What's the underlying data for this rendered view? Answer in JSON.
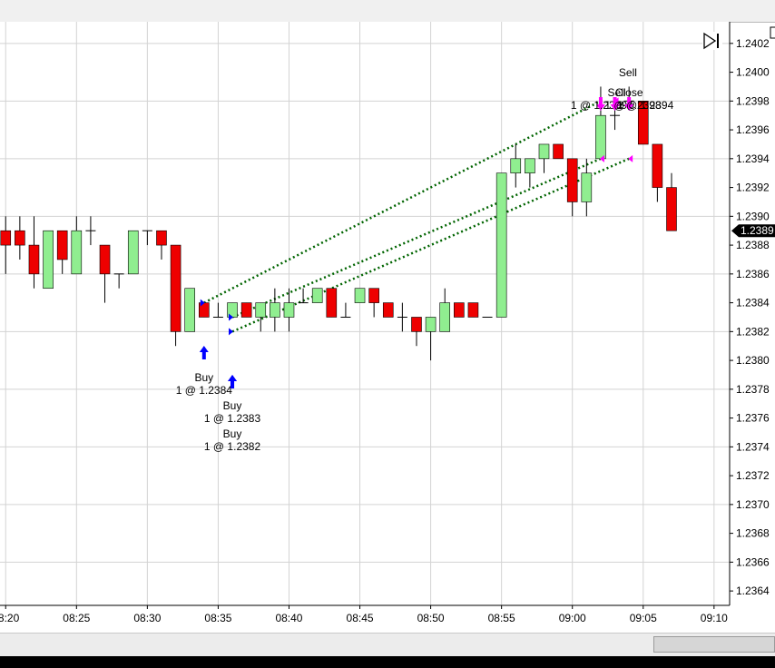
{
  "chart_data": {
    "type": "candlestick",
    "ylim": [
      1.2363,
      1.24035
    ],
    "y_ticks": [
      "1.2364",
      "1.2366",
      "1.2368",
      "1.2370",
      "1.2372",
      "1.2374",
      "1.2376",
      "1.2378",
      "1.2380",
      "1.2382",
      "1.2384",
      "1.2386",
      "1.2388",
      "1.2390",
      "1.2392",
      "1.2394",
      "1.2396",
      "1.2398",
      "1.2400",
      "1.2402"
    ],
    "x_ticks": [
      "08:20",
      "08:25",
      "08:30",
      "08:35",
      "08:40",
      "08:45",
      "08:50",
      "08:55",
      "09:00",
      "09:05",
      "09:10"
    ],
    "x_tick_minutes": [
      500,
      505,
      510,
      515,
      520,
      525,
      530,
      535,
      540,
      545,
      550
    ],
    "xlim_minutes": [
      499.6,
      551.1
    ],
    "last_price": "1.2389",
    "candles": [
      {
        "t": 499,
        "o": 1.239,
        "h": 1.239,
        "l": 1.2389,
        "c": 1.2389
      },
      {
        "t": 500,
        "o": 1.2389,
        "h": 1.239,
        "l": 1.2386,
        "c": 1.2388
      },
      {
        "t": 501,
        "o": 1.2389,
        "h": 1.239,
        "l": 1.2387,
        "c": 1.2388
      },
      {
        "t": 502,
        "o": 1.2388,
        "h": 1.239,
        "l": 1.2385,
        "c": 1.2386
      },
      {
        "t": 503,
        "o": 1.2385,
        "h": 1.2389,
        "l": 1.2385,
        "c": 1.2389
      },
      {
        "t": 504,
        "o": 1.2389,
        "h": 1.2389,
        "l": 1.2386,
        "c": 1.2387
      },
      {
        "t": 505,
        "o": 1.2386,
        "h": 1.239,
        "l": 1.2386,
        "c": 1.2389
      },
      {
        "t": 506,
        "o": 1.2389,
        "h": 1.239,
        "l": 1.2388,
        "c": 1.2389
      },
      {
        "t": 507,
        "o": 1.2388,
        "h": 1.2388,
        "l": 1.2384,
        "c": 1.2386
      },
      {
        "t": 508,
        "o": 1.2386,
        "h": 1.2386,
        "l": 1.2385,
        "c": 1.2386
      },
      {
        "t": 509,
        "o": 1.2386,
        "h": 1.2389,
        "l": 1.2386,
        "c": 1.2389
      },
      {
        "t": 510,
        "o": 1.2389,
        "h": 1.2389,
        "l": 1.2388,
        "c": 1.2389
      },
      {
        "t": 511,
        "o": 1.2389,
        "h": 1.2389,
        "l": 1.2387,
        "c": 1.2388
      },
      {
        "t": 512,
        "o": 1.2388,
        "h": 1.2388,
        "l": 1.2381,
        "c": 1.2382
      },
      {
        "t": 513,
        "o": 1.2382,
        "h": 1.2385,
        "l": 1.2382,
        "c": 1.2385
      },
      {
        "t": 514,
        "o": 1.2384,
        "h": 1.2384,
        "l": 1.2383,
        "c": 1.2383
      },
      {
        "t": 515,
        "o": 1.2383,
        "h": 1.2384,
        "l": 1.2383,
        "c": 1.2383
      },
      {
        "t": 516,
        "o": 1.2383,
        "h": 1.2384,
        "l": 1.2383,
        "c": 1.2384
      },
      {
        "t": 517,
        "o": 1.2384,
        "h": 1.2384,
        "l": 1.2383,
        "c": 1.2383
      },
      {
        "t": 518,
        "o": 1.2383,
        "h": 1.2384,
        "l": 1.2382,
        "c": 1.2384
      },
      {
        "t": 519,
        "o": 1.2383,
        "h": 1.2385,
        "l": 1.2382,
        "c": 1.2384
      },
      {
        "t": 520,
        "o": 1.2383,
        "h": 1.2385,
        "l": 1.2382,
        "c": 1.2384
      },
      {
        "t": 521,
        "o": 1.2384,
        "h": 1.2385,
        "l": 1.2384,
        "c": 1.2384
      },
      {
        "t": 522,
        "o": 1.2384,
        "h": 1.2385,
        "l": 1.2384,
        "c": 1.2385
      },
      {
        "t": 523,
        "o": 1.2385,
        "h": 1.2385,
        "l": 1.2383,
        "c": 1.2383
      },
      {
        "t": 524,
        "o": 1.2383,
        "h": 1.2384,
        "l": 1.2383,
        "c": 1.2383
      },
      {
        "t": 525,
        "o": 1.2384,
        "h": 1.2385,
        "l": 1.2384,
        "c": 1.2385
      },
      {
        "t": 526,
        "o": 1.2385,
        "h": 1.2385,
        "l": 1.2383,
        "c": 1.2384
      },
      {
        "t": 527,
        "o": 1.2384,
        "h": 1.2384,
        "l": 1.2383,
        "c": 1.2383
      },
      {
        "t": 528,
        "o": 1.2383,
        "h": 1.2384,
        "l": 1.2382,
        "c": 1.2383
      },
      {
        "t": 529,
        "o": 1.2383,
        "h": 1.2383,
        "l": 1.2381,
        "c": 1.2382
      },
      {
        "t": 530,
        "o": 1.2382,
        "h": 1.2383,
        "l": 1.238,
        "c": 1.2383
      },
      {
        "t": 531,
        "o": 1.2382,
        "h": 1.2385,
        "l": 1.2382,
        "c": 1.2384
      },
      {
        "t": 532,
        "o": 1.2384,
        "h": 1.2384,
        "l": 1.2383,
        "c": 1.2383
      },
      {
        "t": 533,
        "o": 1.2384,
        "h": 1.2384,
        "l": 1.2383,
        "c": 1.2383
      },
      {
        "t": 534,
        "o": 1.2383,
        "h": 1.2383,
        "l": 1.2383,
        "c": 1.2383
      },
      {
        "t": 535,
        "o": 1.2383,
        "h": 1.2393,
        "l": 1.2383,
        "c": 1.2393
      },
      {
        "t": 536,
        "o": 1.2393,
        "h": 1.2395,
        "l": 1.2392,
        "c": 1.2394
      },
      {
        "t": 537,
        "o": 1.2393,
        "h": 1.2394,
        "l": 1.2392,
        "c": 1.2394
      },
      {
        "t": 538,
        "o": 1.2394,
        "h": 1.2395,
        "l": 1.2393,
        "c": 1.2395
      },
      {
        "t": 539,
        "o": 1.2395,
        "h": 1.2395,
        "l": 1.2394,
        "c": 1.2394
      },
      {
        "t": 540,
        "o": 1.2394,
        "h": 1.2394,
        "l": 1.239,
        "c": 1.2391
      },
      {
        "t": 541,
        "o": 1.2391,
        "h": 1.2394,
        "l": 1.239,
        "c": 1.2393
      },
      {
        "t": 542,
        "o": 1.2394,
        "h": 1.2399,
        "l": 1.2394,
        "c": 1.2397
      },
      {
        "t": 543,
        "o": 1.2397,
        "h": 1.2398,
        "l": 1.2396,
        "c": 1.2397
      },
      {
        "t": 544,
        "o": 1.2398,
        "h": 1.2399,
        "l": 1.2398,
        "c": 1.2398
      },
      {
        "t": 545,
        "o": 1.2398,
        "h": 1.2398,
        "l": 1.2395,
        "c": 1.2395
      },
      {
        "t": 546,
        "o": 1.2395,
        "h": 1.2395,
        "l": 1.2391,
        "c": 1.2392
      },
      {
        "t": 547,
        "o": 1.2392,
        "h": 1.2393,
        "l": 1.2389,
        "c": 1.2389
      }
    ],
    "trades": [
      {
        "side": "buy",
        "t": 514,
        "price": 1.2384,
        "label": "Buy",
        "detail": "1 @ 1.2384"
      },
      {
        "side": "buy",
        "t": 516,
        "price": 1.2383,
        "label": "Buy",
        "detail": "1 @ 1.2383"
      },
      {
        "side": "buy",
        "t": 516,
        "price": 1.2382,
        "label": "Buy",
        "detail": "1 @ 1.2382"
      },
      {
        "side": "sell",
        "t": 542,
        "price": 1.2394,
        "label": "Sell",
        "detail": "1 @ 1.2399"
      },
      {
        "side": "sell",
        "t": 543,
        "price": 1.2398,
        "label": "Sell",
        "detail": "1 @ 1.2398"
      },
      {
        "side": "sell",
        "t": 544,
        "price": 1.2394,
        "label": "Close",
        "detail": "1 @ 1.2394"
      }
    ],
    "trade_lines": [
      {
        "t1": 514,
        "p1": 1.2384,
        "t2": 542,
        "p2": 1.2398
      },
      {
        "t1": 516,
        "p1": 1.2383,
        "t2": 542,
        "p2": 1.2394
      },
      {
        "t1": 516,
        "p1": 1.2382,
        "t2": 544,
        "p2": 1.2394
      }
    ]
  },
  "colors": {
    "up": "#90ee90",
    "down": "#ee0000",
    "grid": "#d3d3d3",
    "buy_marker": "#0000ff",
    "sell_marker": "#ff00ff",
    "trade_line": "#006400",
    "price_tag": "#000000"
  },
  "icons": {
    "scroll_end": "skip-to-end-icon"
  }
}
